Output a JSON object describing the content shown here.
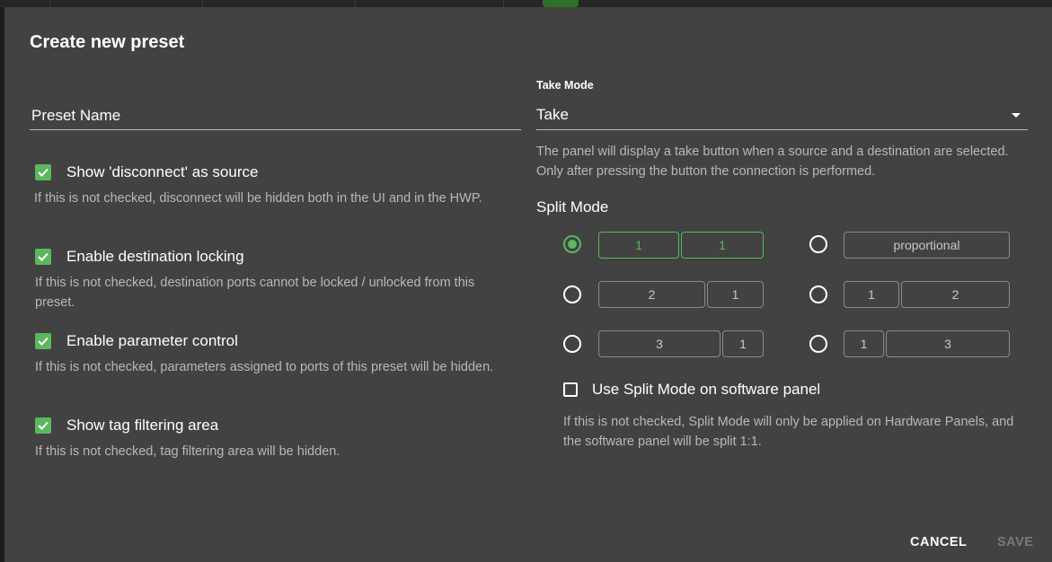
{
  "dialog": {
    "title": "Create new preset",
    "preset_name_placeholder": "Preset Name",
    "options": [
      {
        "label": "Show 'disconnect' as source",
        "help": "If this is not checked, disconnect will be hidden both in the UI and in the HWP.",
        "checked": true
      },
      {
        "label": "Enable destination locking",
        "help": "If this is not checked, destination ports cannot be locked / unlocked from this preset.",
        "checked": true
      },
      {
        "label": "Enable parameter control",
        "help": "If this is not checked, parameters assigned to ports of this preset will be hidden.",
        "checked": true
      },
      {
        "label": "Show tag filtering area",
        "help": "If this is not checked, tag filtering area will be hidden.",
        "checked": true
      }
    ],
    "take_mode": {
      "label": "Take Mode",
      "value": "Take",
      "help": "The panel will display a take button when a source and a destination are selected. Only after pressing the button the connection is performed."
    },
    "split_mode": {
      "label": "Split Mode",
      "options": [
        {
          "parts": [
            "1",
            "1"
          ],
          "selected": true
        },
        {
          "parts": [
            "proportional"
          ],
          "selected": false
        },
        {
          "parts": [
            "2",
            "1"
          ],
          "selected": false
        },
        {
          "parts": [
            "1",
            "2"
          ],
          "selected": false
        },
        {
          "parts": [
            "3",
            "1"
          ],
          "selected": false
        },
        {
          "parts": [
            "1",
            "3"
          ],
          "selected": false
        }
      ],
      "software_panel_label": "Use Split Mode on software panel",
      "software_panel_checked": false,
      "software_panel_help": "If this is not checked, Split Mode will only be applied on Hardware Panels, and the software panel will be split 1:1."
    },
    "buttons": {
      "cancel": "CANCEL",
      "save": "SAVE"
    },
    "colors": {
      "accent": "#5cb85c",
      "dialog_bg": "#424242",
      "backdrop": "#1e1e1e"
    }
  }
}
